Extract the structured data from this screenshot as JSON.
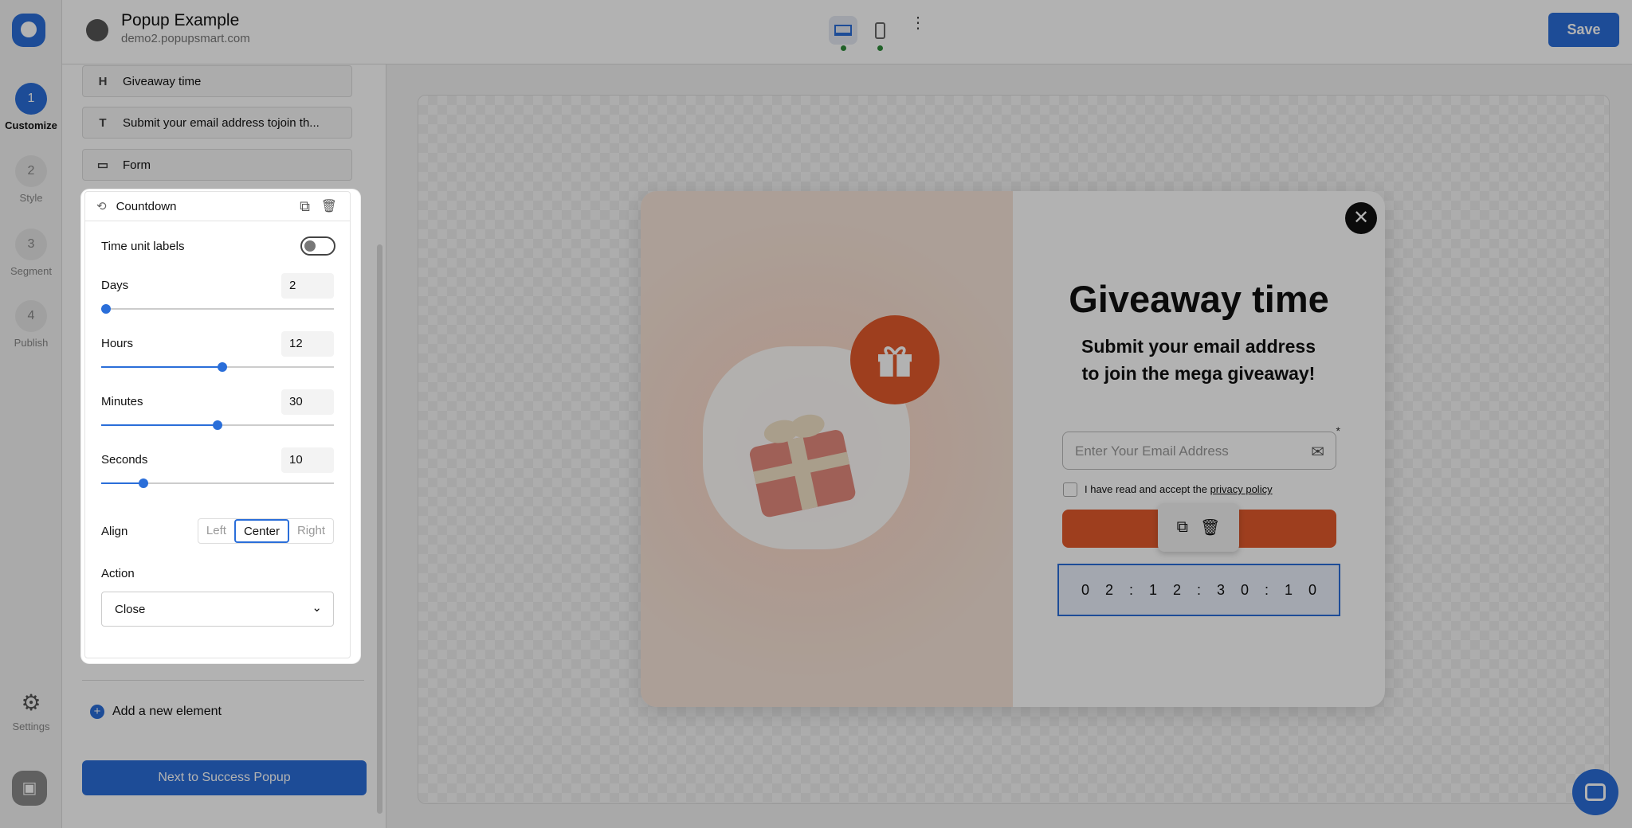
{
  "app": {
    "title": "Popup Example",
    "domain": "demo2.popupsmart.com",
    "save_label": "Save",
    "brand_color": "#2a6ed9"
  },
  "rail": {
    "steps": [
      {
        "num": "1",
        "label": "Customize",
        "active": true
      },
      {
        "num": "2",
        "label": "Style"
      },
      {
        "num": "3",
        "label": "Segment"
      },
      {
        "num": "4",
        "label": "Publish"
      }
    ],
    "settings_label": "Settings"
  },
  "toolbar": {
    "devices": [
      "desktop-icon",
      "mobile-icon"
    ],
    "active_device": "desktop"
  },
  "panel": {
    "elements": [
      {
        "icon": "H",
        "label": "Giveaway time"
      },
      {
        "icon": "T",
        "label": "Submit your email address tojoin th..."
      },
      {
        "icon": "form-icon",
        "label": "Form"
      }
    ],
    "countdown": {
      "label": "Countdown",
      "time_unit_labels_label": "Time unit labels",
      "time_unit_labels_on": false,
      "days": {
        "label": "Days",
        "value": "2",
        "fraction": 0.02
      },
      "hours": {
        "label": "Hours",
        "value": "12",
        "fraction": 0.52
      },
      "minutes": {
        "label": "Minutes",
        "value": "30",
        "fraction": 0.5
      },
      "seconds": {
        "label": "Seconds",
        "value": "10",
        "fraction": 0.18
      },
      "align": {
        "label": "Align",
        "options": [
          "Left",
          "Center",
          "Right"
        ],
        "selected": "Center"
      },
      "action": {
        "label": "Action",
        "value": "Close"
      }
    },
    "add_element_label": "Add a new element",
    "next_label": "Next to Success Popup"
  },
  "popup": {
    "title": "Giveaway time",
    "subtitle": "Submit your email address to join the mega giveaway!",
    "email_placeholder": "Enter Your Email Address",
    "required_mark": "*",
    "consent_text": "I have read and accept the ",
    "consent_link": "privacy policy",
    "countdown_digits": [
      "0",
      "2",
      ":",
      "1",
      "2",
      ":",
      "3",
      "0",
      ":",
      "1",
      "0"
    ],
    "accent": "#e25a2c",
    "close_label": "✕"
  }
}
